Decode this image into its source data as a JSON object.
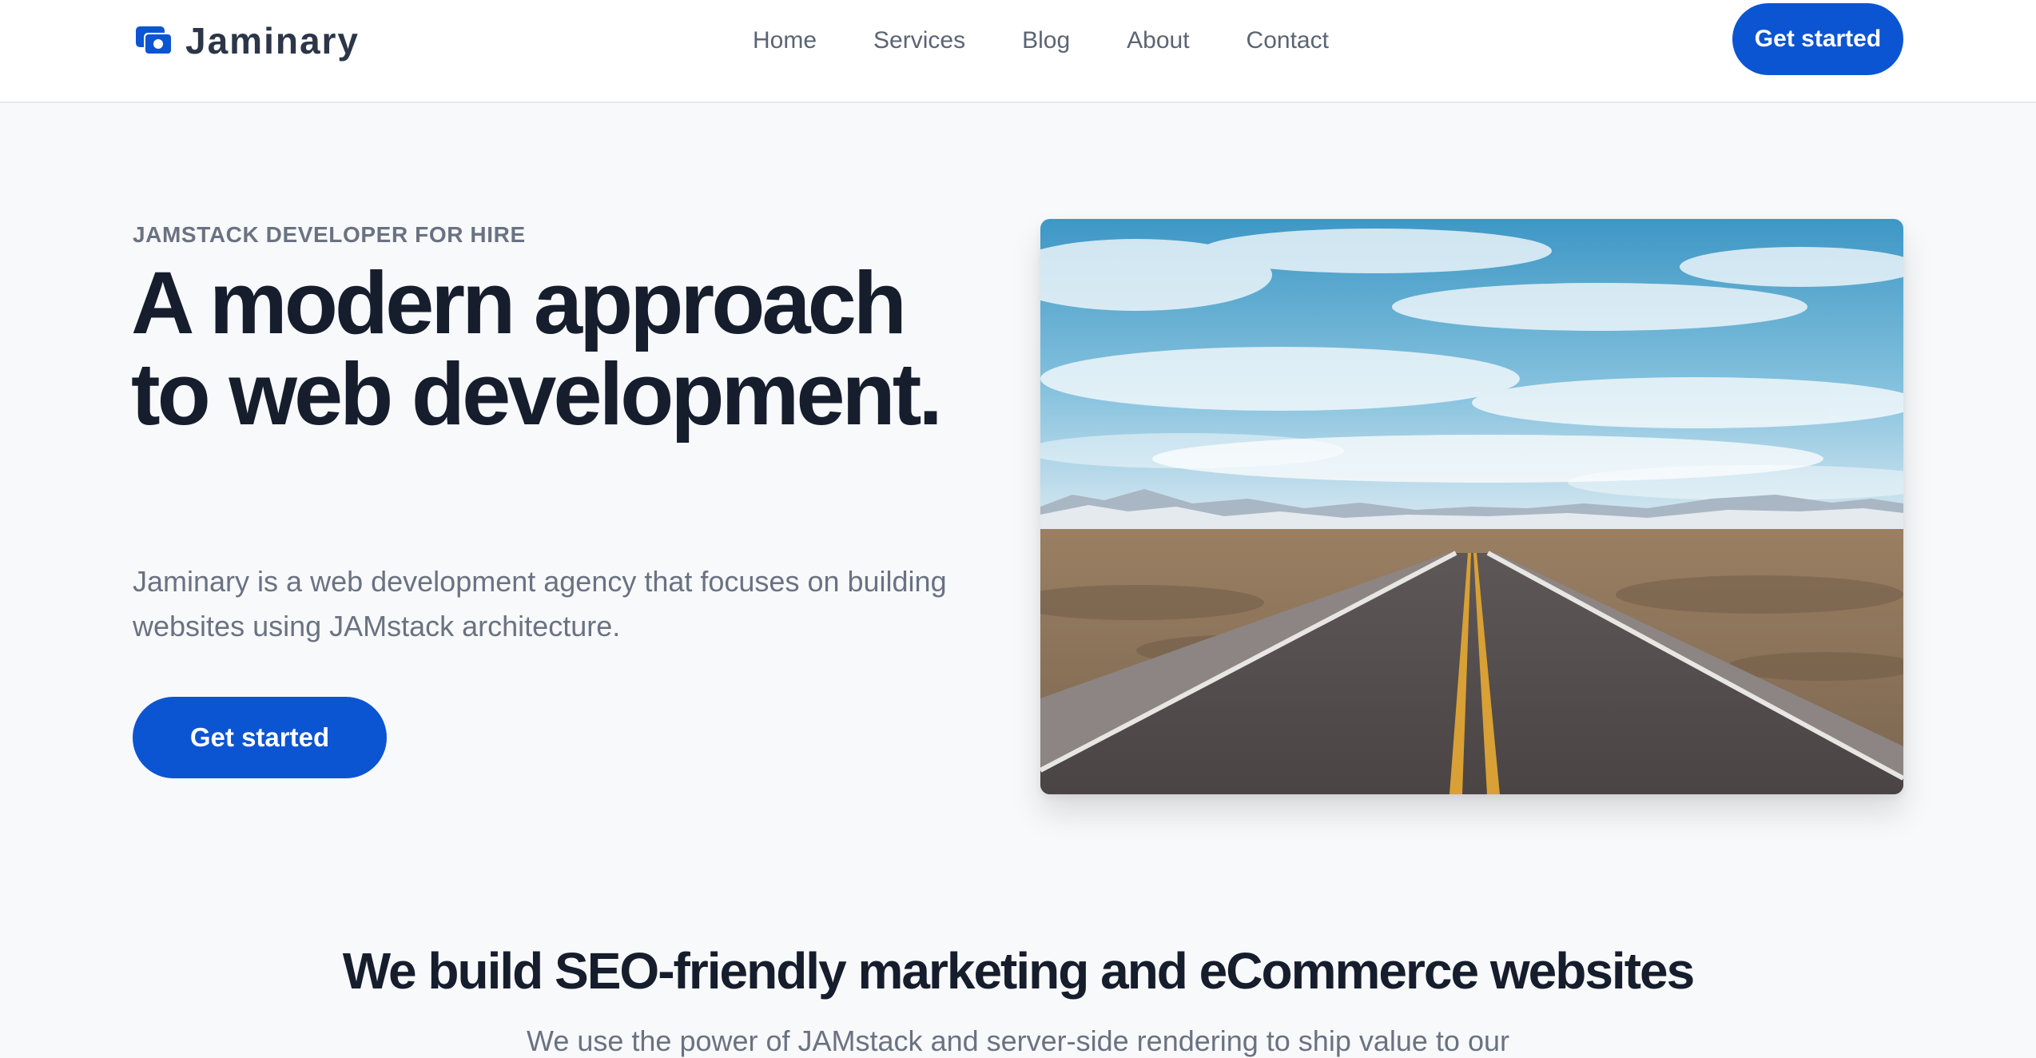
{
  "brand": {
    "name": "Jaminary",
    "accent_color": "#0c55d2",
    "logo_icon": "camera-icon"
  },
  "nav": {
    "items": [
      {
        "label": "Home"
      },
      {
        "label": "Services"
      },
      {
        "label": "Blog"
      },
      {
        "label": "About"
      },
      {
        "label": "Contact"
      }
    ],
    "cta_label": "Get started"
  },
  "hero": {
    "eyebrow": "JAMSTACK DEVELOPER FOR HIRE",
    "title": "A modern approach to web development.",
    "subtitle": "Jaminary is a web development agency that focuses on building websites using JAMstack architecture.",
    "cta_label": "Get started",
    "image_subject": "desert-highway-photo"
  },
  "section": {
    "title": "We build SEO-friendly marketing and eCommerce websites",
    "subtitle": "We use the power of JAMstack and server-side rendering to ship value to our"
  }
}
